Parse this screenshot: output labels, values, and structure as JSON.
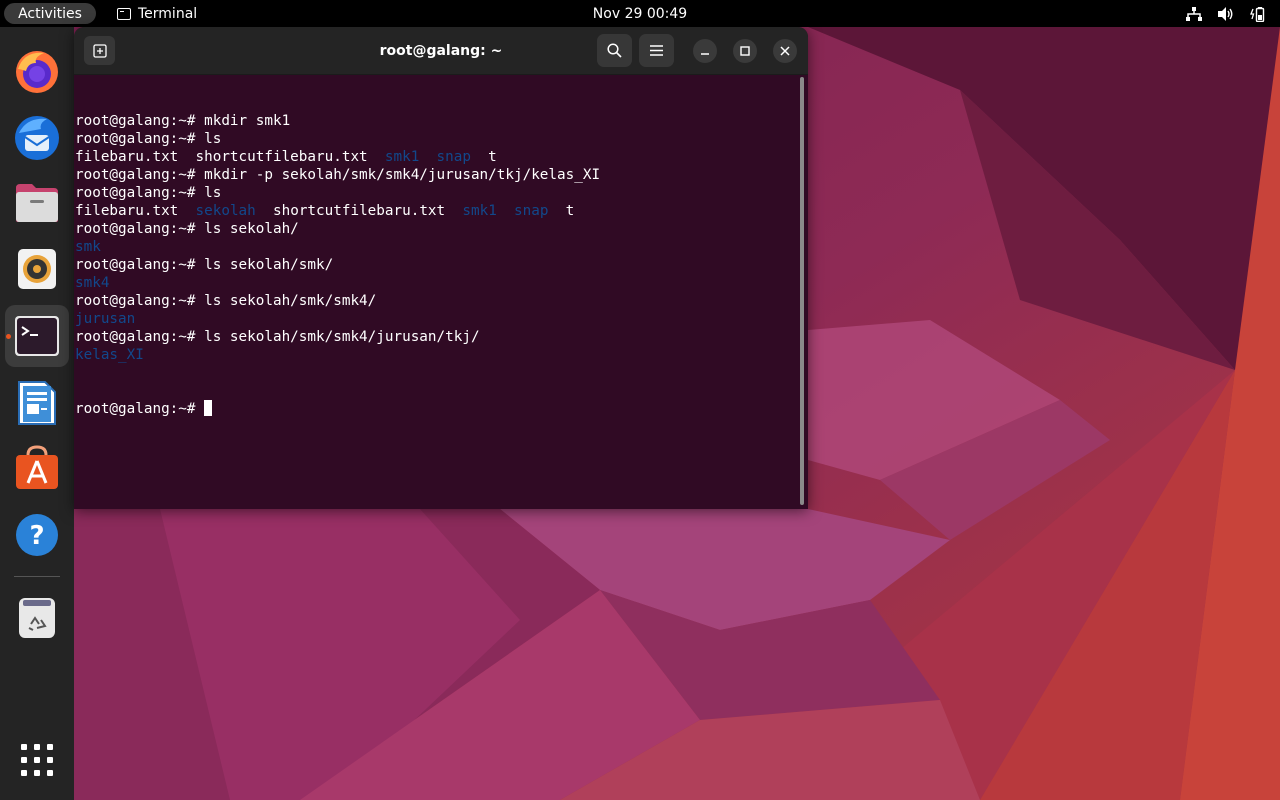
{
  "topbar": {
    "activities": "Activities",
    "app_name": "Terminal",
    "clock": "Nov 29  00:49"
  },
  "dock": {
    "items": [
      "firefox",
      "thunderbird",
      "files",
      "rhythmbox",
      "terminal",
      "libreoffice-writer",
      "ubuntu-software",
      "help",
      "trash",
      "show-apps"
    ]
  },
  "terminal": {
    "title": "root@galang: ~",
    "prompt": "root@galang:~# ",
    "lines": [
      [
        {
          "t": "root@galang:~# mkdir smk1"
        }
      ],
      [
        {
          "t": "root@galang:~# ls"
        }
      ],
      [
        {
          "t": "filebaru.txt  shortcutfilebaru.txt  "
        },
        {
          "t": "smk1",
          "c": "dir"
        },
        {
          "t": "  "
        },
        {
          "t": "snap",
          "c": "dir"
        },
        {
          "t": "  t"
        }
      ],
      [
        {
          "t": "root@galang:~# mkdir -p sekolah/smk/smk4/jurusan/tkj/kelas_XI"
        }
      ],
      [
        {
          "t": "root@galang:~# ls"
        }
      ],
      [
        {
          "t": "filebaru.txt  "
        },
        {
          "t": "sekolah",
          "c": "dir"
        },
        {
          "t": "  shortcutfilebaru.txt  "
        },
        {
          "t": "smk1",
          "c": "dir"
        },
        {
          "t": "  "
        },
        {
          "t": "snap",
          "c": "dir"
        },
        {
          "t": "  t"
        }
      ],
      [
        {
          "t": "root@galang:~# ls sekolah/"
        }
      ],
      [
        {
          "t": "smk",
          "c": "dir"
        }
      ],
      [
        {
          "t": "root@galang:~# ls sekolah/smk/"
        }
      ],
      [
        {
          "t": "smk4",
          "c": "dir"
        }
      ],
      [
        {
          "t": "root@galang:~# ls sekolah/smk/smk4/"
        }
      ],
      [
        {
          "t": "jurusan",
          "c": "dir"
        }
      ],
      [
        {
          "t": "root@galang:~# ls sekolah/smk/smk4/jurusan/tkj/"
        }
      ],
      [
        {
          "t": "kelas_XI",
          "c": "dir"
        }
      ]
    ]
  },
  "colors": {
    "terminal_bg": "#300a24",
    "directory": "#12488b",
    "accent": "#e95420"
  }
}
